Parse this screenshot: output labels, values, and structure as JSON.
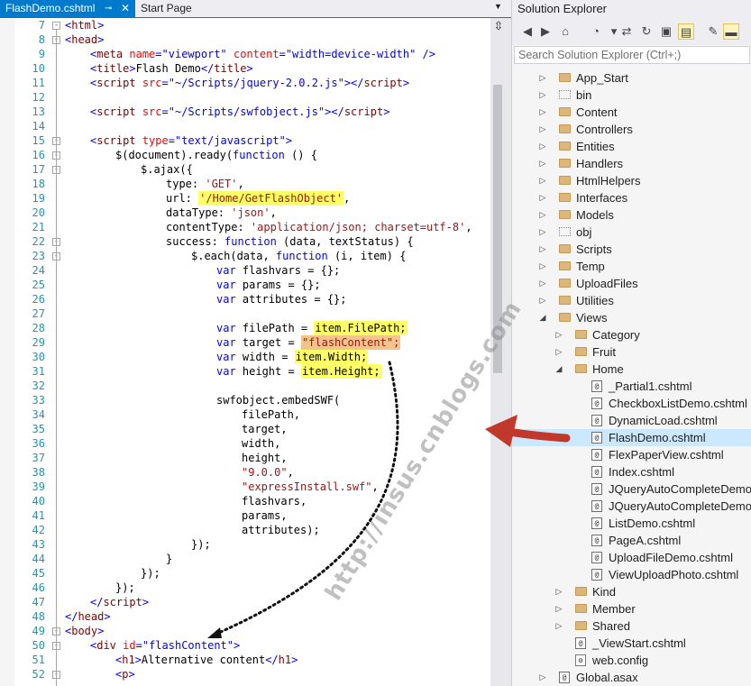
{
  "editor": {
    "tabs": [
      {
        "label": "FlashDemo.cshtml",
        "active": true
      },
      {
        "label": "Start Page",
        "active": false
      }
    ],
    "pin_glyph": "⊸",
    "close_glyph": "✕",
    "dropdown_glyph": "▼",
    "split_glyph": "⇳"
  },
  "code_lines": [
    {
      "n": "7",
      "fold": "-",
      "indent": 0,
      "segs": [
        [
          "<",
          "punc"
        ],
        [
          "html",
          "tag"
        ],
        [
          ">",
          "punc"
        ]
      ]
    },
    {
      "n": "8",
      "fold": "-",
      "indent": 0,
      "segs": [
        [
          "<",
          "punc"
        ],
        [
          "head",
          "tag"
        ],
        [
          ">",
          "punc"
        ]
      ]
    },
    {
      "n": "9",
      "indent": 1,
      "segs": [
        [
          "<",
          "punc"
        ],
        [
          "meta",
          "tag"
        ],
        [
          " ",
          "plain"
        ],
        [
          "name",
          "attr"
        ],
        [
          "=",
          "punc"
        ],
        [
          "\"viewport\"",
          "val"
        ],
        [
          " ",
          "plain"
        ],
        [
          "content",
          "attr"
        ],
        [
          "=",
          "punc"
        ],
        [
          "\"width=device-width\"",
          "val"
        ],
        [
          " />",
          "punc"
        ]
      ]
    },
    {
      "n": "10",
      "indent": 1,
      "segs": [
        [
          "<",
          "punc"
        ],
        [
          "title",
          "tag"
        ],
        [
          ">",
          "punc"
        ],
        [
          "Flash Demo",
          "plain"
        ],
        [
          "</",
          "punc"
        ],
        [
          "title",
          "tag"
        ],
        [
          ">",
          "punc"
        ]
      ]
    },
    {
      "n": "11",
      "indent": 1,
      "segs": [
        [
          "<",
          "punc"
        ],
        [
          "script",
          "tag"
        ],
        [
          " ",
          "plain"
        ],
        [
          "src",
          "attr"
        ],
        [
          "=",
          "punc"
        ],
        [
          "\"~/Scripts/jquery-2.0.2.js\"",
          "val"
        ],
        [
          "></",
          "punc"
        ],
        [
          "script",
          "tag"
        ],
        [
          ">",
          "punc"
        ]
      ]
    },
    {
      "n": "12",
      "indent": 0,
      "segs": []
    },
    {
      "n": "13",
      "indent": 1,
      "segs": [
        [
          "<",
          "punc"
        ],
        [
          "script",
          "tag"
        ],
        [
          " ",
          "plain"
        ],
        [
          "src",
          "attr"
        ],
        [
          "=",
          "punc"
        ],
        [
          "\"~/Scripts/swfobject.js\"",
          "val"
        ],
        [
          "></",
          "punc"
        ],
        [
          "script",
          "tag"
        ],
        [
          ">",
          "punc"
        ]
      ]
    },
    {
      "n": "14",
      "indent": 0,
      "segs": []
    },
    {
      "n": "15",
      "fold": "-",
      "indent": 1,
      "segs": [
        [
          "<",
          "punc"
        ],
        [
          "script",
          "tag"
        ],
        [
          " ",
          "plain"
        ],
        [
          "type",
          "attr"
        ],
        [
          "=",
          "punc"
        ],
        [
          "\"text/javascript\"",
          "val"
        ],
        [
          ">",
          "punc"
        ]
      ]
    },
    {
      "n": "16",
      "fold": "-",
      "indent": 2,
      "segs": [
        [
          "$(document).ready(",
          "plain"
        ],
        [
          "function",
          "kw"
        ],
        [
          " () {",
          "plain"
        ]
      ]
    },
    {
      "n": "17",
      "fold": "-",
      "indent": 3,
      "segs": [
        [
          "$.ajax({",
          "plain"
        ]
      ]
    },
    {
      "n": "18",
      "indent": 4,
      "segs": [
        [
          "type: ",
          "plain"
        ],
        [
          "'GET'",
          "str"
        ],
        [
          ",",
          "plain"
        ]
      ]
    },
    {
      "n": "19",
      "indent": 4,
      "segs": [
        [
          "url: ",
          "plain"
        ],
        [
          "'/Home/GetFlashObject'",
          "str",
          "y"
        ],
        [
          ",",
          "plain"
        ]
      ]
    },
    {
      "n": "20",
      "indent": 4,
      "segs": [
        [
          "dataType: ",
          "plain"
        ],
        [
          "'json'",
          "str"
        ],
        [
          ",",
          "plain"
        ]
      ]
    },
    {
      "n": "21",
      "indent": 4,
      "segs": [
        [
          "contentType: ",
          "plain"
        ],
        [
          "'application/json; charset=utf-8'",
          "str"
        ],
        [
          ",",
          "plain"
        ]
      ]
    },
    {
      "n": "22",
      "fold": "-",
      "indent": 4,
      "segs": [
        [
          "success: ",
          "plain"
        ],
        [
          "function",
          "kw"
        ],
        [
          " (data, textStatus) {",
          "plain"
        ]
      ]
    },
    {
      "n": "23",
      "fold": "-",
      "indent": 5,
      "segs": [
        [
          "$.each(data, ",
          "plain"
        ],
        [
          "function",
          "kw"
        ],
        [
          " (i, item) {",
          "plain"
        ]
      ]
    },
    {
      "n": "24",
      "indent": 6,
      "segs": [
        [
          "var",
          "kw"
        ],
        [
          " flashvars = {};",
          "plain"
        ]
      ]
    },
    {
      "n": "25",
      "indent": 6,
      "segs": [
        [
          "var",
          "kw"
        ],
        [
          " params = {};",
          "plain"
        ]
      ]
    },
    {
      "n": "26",
      "indent": 6,
      "segs": [
        [
          "var",
          "kw"
        ],
        [
          " attributes = {};",
          "plain"
        ]
      ]
    },
    {
      "n": "27",
      "indent": 0,
      "segs": []
    },
    {
      "n": "28",
      "indent": 6,
      "segs": [
        [
          "var",
          "kw"
        ],
        [
          " filePath = ",
          "plain"
        ],
        [
          "item.FilePath;",
          "plain",
          "y"
        ]
      ]
    },
    {
      "n": "29",
      "indent": 6,
      "segs": [
        [
          "var",
          "kw"
        ],
        [
          " target = ",
          "plain"
        ],
        [
          "\"flashContent\";",
          "str",
          "o"
        ]
      ]
    },
    {
      "n": "30",
      "indent": 6,
      "segs": [
        [
          "var",
          "kw"
        ],
        [
          " width = ",
          "plain"
        ],
        [
          "item.Width;",
          "plain",
          "y"
        ]
      ]
    },
    {
      "n": "31",
      "indent": 6,
      "segs": [
        [
          "var",
          "kw"
        ],
        [
          " height = ",
          "plain"
        ],
        [
          "item.Height;",
          "plain",
          "y"
        ]
      ]
    },
    {
      "n": "32",
      "indent": 0,
      "segs": []
    },
    {
      "n": "33",
      "indent": 6,
      "segs": [
        [
          "swfobject.embedSWF(",
          "plain"
        ]
      ]
    },
    {
      "n": "34",
      "indent": 7,
      "segs": [
        [
          "filePath,",
          "plain"
        ]
      ]
    },
    {
      "n": "35",
      "indent": 7,
      "segs": [
        [
          "target,",
          "plain"
        ]
      ]
    },
    {
      "n": "36",
      "indent": 7,
      "segs": [
        [
          "width,",
          "plain"
        ]
      ]
    },
    {
      "n": "37",
      "indent": 7,
      "segs": [
        [
          "height,",
          "plain"
        ]
      ]
    },
    {
      "n": "38",
      "indent": 7,
      "segs": [
        [
          "\"9.0.0\"",
          "str"
        ],
        [
          ",",
          "plain"
        ]
      ]
    },
    {
      "n": "39",
      "indent": 7,
      "segs": [
        [
          "\"expressInstall.swf\"",
          "str"
        ],
        [
          ",",
          "plain"
        ]
      ]
    },
    {
      "n": "40",
      "indent": 7,
      "segs": [
        [
          "flashvars,",
          "plain"
        ]
      ]
    },
    {
      "n": "41",
      "indent": 7,
      "segs": [
        [
          "params,",
          "plain"
        ]
      ]
    },
    {
      "n": "42",
      "indent": 7,
      "segs": [
        [
          "attributes);",
          "plain"
        ]
      ]
    },
    {
      "n": "43",
      "indent": 5,
      "segs": [
        [
          "});",
          "plain"
        ]
      ]
    },
    {
      "n": "44",
      "indent": 4,
      "segs": [
        [
          "}",
          "plain"
        ]
      ]
    },
    {
      "n": "45",
      "indent": 3,
      "segs": [
        [
          "});",
          "plain"
        ]
      ]
    },
    {
      "n": "46",
      "indent": 2,
      "segs": [
        [
          "});",
          "plain"
        ]
      ]
    },
    {
      "n": "47",
      "indent": 1,
      "segs": [
        [
          "</",
          "punc"
        ],
        [
          "script",
          "tag"
        ],
        [
          ">",
          "punc"
        ]
      ]
    },
    {
      "n": "48",
      "indent": 0,
      "segs": [
        [
          "</",
          "punc"
        ],
        [
          "head",
          "tag"
        ],
        [
          ">",
          "punc"
        ]
      ]
    },
    {
      "n": "49",
      "fold": "-",
      "indent": 0,
      "segs": [
        [
          "<",
          "punc"
        ],
        [
          "body",
          "tag"
        ],
        [
          ">",
          "punc"
        ]
      ]
    },
    {
      "n": "50",
      "fold": "-",
      "indent": 1,
      "segs": [
        [
          "<",
          "punc"
        ],
        [
          "div",
          "tag"
        ],
        [
          " ",
          "plain"
        ],
        [
          "id",
          "attr"
        ],
        [
          "=",
          "punc"
        ],
        [
          "\"flashContent\"",
          "val"
        ],
        [
          ">",
          "punc"
        ]
      ]
    },
    {
      "n": "51",
      "indent": 2,
      "segs": [
        [
          "<",
          "punc"
        ],
        [
          "h1",
          "tag"
        ],
        [
          ">",
          "punc"
        ],
        [
          "Alternative content",
          "plain"
        ],
        [
          "</",
          "punc"
        ],
        [
          "h1",
          "tag"
        ],
        [
          ">",
          "punc"
        ]
      ]
    },
    {
      "n": "52",
      "fold": "-",
      "indent": 2,
      "segs": [
        [
          "<",
          "punc"
        ],
        [
          "p",
          "tag"
        ],
        [
          ">",
          "punc"
        ]
      ]
    }
  ],
  "solution_explorer": {
    "title": "Solution Explorer",
    "search_placeholder": "Search Solution Explorer (Ctrl+;)",
    "toolbar_icons": [
      {
        "name": "back-icon",
        "glyph": "◀"
      },
      {
        "name": "forward-icon",
        "glyph": "▶"
      },
      {
        "name": "home-icon",
        "glyph": "⌂"
      },
      {
        "name": "history-icon",
        "glyph": "◔"
      },
      {
        "name": "dropdown-icon",
        "glyph": "▾"
      },
      {
        "name": "sync-icon",
        "glyph": "⇄"
      },
      {
        "name": "refresh-icon",
        "glyph": "↻"
      },
      {
        "name": "collapse-all-icon",
        "glyph": "▣"
      },
      {
        "name": "show-all-files-icon",
        "glyph": "▤"
      },
      {
        "name": "properties-icon",
        "glyph": "✎"
      },
      {
        "name": "auto-hide-icon",
        "glyph": "▬"
      }
    ],
    "items": [
      {
        "label": "App_Start",
        "depth": 0,
        "icon": "folder",
        "arrow": "▷"
      },
      {
        "label": "bin",
        "depth": 0,
        "icon": "folder-dotted",
        "arrow": "▷"
      },
      {
        "label": "Content",
        "depth": 0,
        "icon": "folder",
        "arrow": "▷"
      },
      {
        "label": "Controllers",
        "depth": 0,
        "icon": "folder",
        "arrow": "▷"
      },
      {
        "label": "Entities",
        "depth": 0,
        "icon": "folder",
        "arrow": "▷"
      },
      {
        "label": "Handlers",
        "depth": 0,
        "icon": "folder",
        "arrow": "▷"
      },
      {
        "label": "HtmlHelpers",
        "depth": 0,
        "icon": "folder",
        "arrow": "▷"
      },
      {
        "label": "Interfaces",
        "depth": 0,
        "icon": "folder",
        "arrow": "▷"
      },
      {
        "label": "Models",
        "depth": 0,
        "icon": "folder",
        "arrow": "▷"
      },
      {
        "label": "obj",
        "depth": 0,
        "icon": "folder-dotted",
        "arrow": "▷"
      },
      {
        "label": "Scripts",
        "depth": 0,
        "icon": "folder",
        "arrow": "▷"
      },
      {
        "label": "Temp",
        "depth": 0,
        "icon": "folder",
        "arrow": "▷"
      },
      {
        "label": "UploadFiles",
        "depth": 0,
        "icon": "folder",
        "arrow": "▷"
      },
      {
        "label": "Utilities",
        "depth": 0,
        "icon": "folder",
        "arrow": "▷"
      },
      {
        "label": "Views",
        "depth": 0,
        "icon": "folder",
        "arrow": "◢"
      },
      {
        "label": "Category",
        "depth": 1,
        "icon": "folder",
        "arrow": "▷"
      },
      {
        "label": "Fruit",
        "depth": 1,
        "icon": "folder",
        "arrow": "▷"
      },
      {
        "label": "Home",
        "depth": 1,
        "icon": "folder",
        "arrow": "◢"
      },
      {
        "label": "_Partial1.cshtml",
        "depth": 2,
        "icon": "file"
      },
      {
        "label": "CheckboxListDemo.cshtml",
        "depth": 2,
        "icon": "file"
      },
      {
        "label": "DynamicLoad.cshtml",
        "depth": 2,
        "icon": "file"
      },
      {
        "label": "FlashDemo.cshtml",
        "depth": 2,
        "icon": "file",
        "selected": true
      },
      {
        "label": "FlexPaperView.cshtml",
        "depth": 2,
        "icon": "file"
      },
      {
        "label": "Index.cshtml",
        "depth": 2,
        "icon": "file"
      },
      {
        "label": "JQueryAutoCompleteDemo",
        "depth": 2,
        "icon": "file"
      },
      {
        "label": "JQueryAutoCompleteDemo",
        "depth": 2,
        "icon": "file"
      },
      {
        "label": "ListDemo.cshtml",
        "depth": 2,
        "icon": "file"
      },
      {
        "label": "PageA.cshtml",
        "depth": 2,
        "icon": "file"
      },
      {
        "label": "UploadFileDemo.cshtml",
        "depth": 2,
        "icon": "file"
      },
      {
        "label": "ViewUploadPhoto.cshtml",
        "depth": 2,
        "icon": "file"
      },
      {
        "label": "Kind",
        "depth": 1,
        "icon": "folder",
        "arrow": "▷"
      },
      {
        "label": "Member",
        "depth": 1,
        "icon": "folder",
        "arrow": "▷"
      },
      {
        "label": "Shared",
        "depth": 1,
        "icon": "folder",
        "arrow": "▷"
      },
      {
        "label": "_ViewStart.cshtml",
        "depth": 1,
        "icon": "file"
      },
      {
        "label": "web.config",
        "depth": 1,
        "icon": "file-gear"
      },
      {
        "label": "Global.asax",
        "depth": 0,
        "icon": "file",
        "arrow": "▷"
      }
    ]
  },
  "watermark": "http://insus.cnblogs.com",
  "colors": {
    "accent": "#007acc",
    "highlight_yellow": "#ffff66",
    "highlight_orange": "#f4c48c",
    "annotation_arrow": "#c0392b"
  }
}
